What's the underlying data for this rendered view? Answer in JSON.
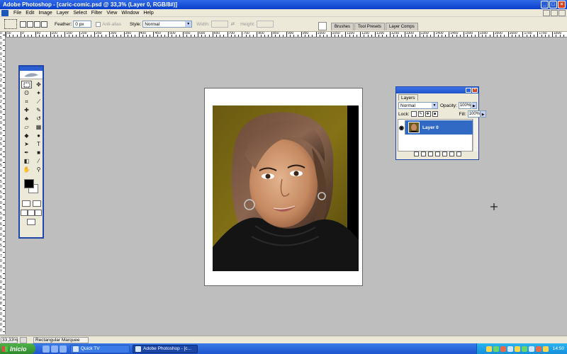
{
  "window": {
    "title": "Adobe Photoshop - [caric-comic.psd @ 33,3% (Layer 0, RGB/8#)]",
    "minimize": "_",
    "maximize": "□",
    "close": "×"
  },
  "menu": {
    "items": [
      "File",
      "Edit",
      "Image",
      "Layer",
      "Select",
      "Filter",
      "View",
      "Window",
      "Help"
    ]
  },
  "options": {
    "feather_label": "Feather:",
    "feather_value": "0 px",
    "antialias_label": "Anti-alias",
    "style_label": "Style:",
    "style_value": "Normal",
    "width_label": "Width:",
    "height_label": "Height:"
  },
  "palette_well": {
    "tabs": [
      "Brushes",
      "Tool Presets",
      "Layer Comps"
    ]
  },
  "rulers": {
    "top": [
      "50",
      "0",
      "50",
      "100",
      "150",
      "200",
      "250",
      "300",
      "350",
      "400",
      "450",
      "500",
      "550",
      "600",
      "650",
      "700",
      "750",
      "800",
      "850",
      "900",
      "950",
      "1000",
      "1050",
      "1100",
      "1150",
      "1200",
      "1250",
      "1300",
      "1350",
      "1400",
      "1450",
      "1500",
      "1550",
      "1600",
      "1650",
      "1700",
      "1750",
      "1800"
    ],
    "left": [
      "0",
      "5",
      "0",
      "5",
      "0",
      "1",
      "1",
      "5",
      "0",
      "2",
      "0",
      "5",
      "0",
      "2",
      "5",
      "0",
      "3",
      "0",
      "5",
      "0",
      "3",
      "5",
      "0",
      "4",
      "0",
      "5",
      "0",
      "4",
      "5",
      "0",
      "5",
      "0",
      "0",
      "5",
      "5",
      "0",
      "6",
      "0",
      "0",
      "6",
      "5",
      "0",
      "7",
      "0",
      "0",
      "7",
      "5",
      "0",
      "8",
      "0",
      "0",
      "8",
      "5",
      "0",
      "9",
      "0",
      "0"
    ]
  },
  "layers_panel": {
    "tab": "Layers",
    "blend_mode": "Normal",
    "opacity_label": "Opacity:",
    "opacity_value": "100%",
    "lock_label": "Lock:",
    "fill_label": "Fill:",
    "fill_value": "100%",
    "layer_name": "Layer 0"
  },
  "statusbar": {
    "zoom": "33,33%",
    "tool_info": "Rectangular Marquee"
  },
  "taskbar": {
    "start": "Inicio",
    "tasks": [
      "Quick TV",
      "Adobe Photoshop - [c..."
    ],
    "clock": "14:50"
  }
}
